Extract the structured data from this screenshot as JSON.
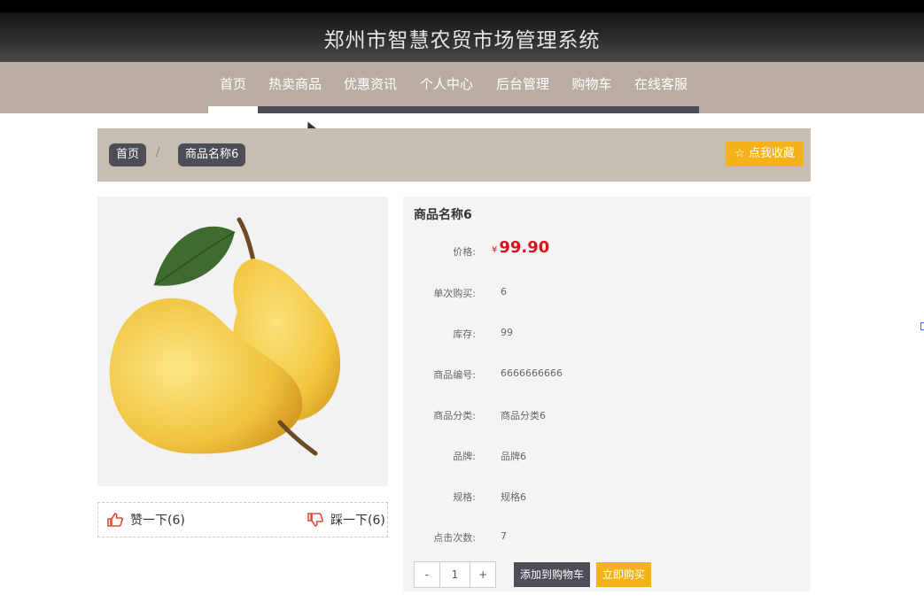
{
  "header": {
    "title": "郑州市智慧农贸市场管理系统"
  },
  "nav": {
    "items": [
      {
        "label": "首页",
        "active": true
      },
      {
        "label": "热卖商品",
        "active": false
      },
      {
        "label": "优惠资讯",
        "active": false
      },
      {
        "label": "个人中心",
        "active": false
      },
      {
        "label": "后台管理",
        "active": false
      },
      {
        "label": "购物车",
        "active": false
      },
      {
        "label": "在线客服",
        "active": false
      }
    ]
  },
  "breadcrumb": {
    "home": "首页",
    "separator": "/",
    "current": "商品名称6"
  },
  "favorite": {
    "label": "点我收藏",
    "icon": "star-outline-icon"
  },
  "product": {
    "title": "商品名称6",
    "price_label": "价格:",
    "currency": "¥",
    "price": "99.90",
    "details": [
      {
        "label": "单次购买:",
        "value": "6"
      },
      {
        "label": "库存:",
        "value": "99"
      },
      {
        "label": "商品编号:",
        "value": "6666666666"
      },
      {
        "label": "商品分类:",
        "value": "商品分类6"
      },
      {
        "label": "品牌:",
        "value": "品牌6"
      },
      {
        "label": "规格:",
        "value": "规格6"
      },
      {
        "label": "点击次数:",
        "value": "7"
      }
    ],
    "image": {
      "subject": "pears",
      "icon": "pear-image"
    }
  },
  "votes": {
    "like_label": "赞一下(6)",
    "dislike_label": "踩一下(6)",
    "like_icon": "thumbs-up-icon",
    "dislike_icon": "thumbs-down-icon",
    "icon_color": "#e8473c"
  },
  "purchase": {
    "minus": "-",
    "quantity": "1",
    "plus": "+",
    "add_to_cart": "添加到购物车",
    "buy_now": "立即购买"
  },
  "colors": {
    "nav_bg": "#b9ada3",
    "dark_accent": "#4d4d57",
    "orange": "#f5b11a",
    "price_red": "#d9131d"
  }
}
